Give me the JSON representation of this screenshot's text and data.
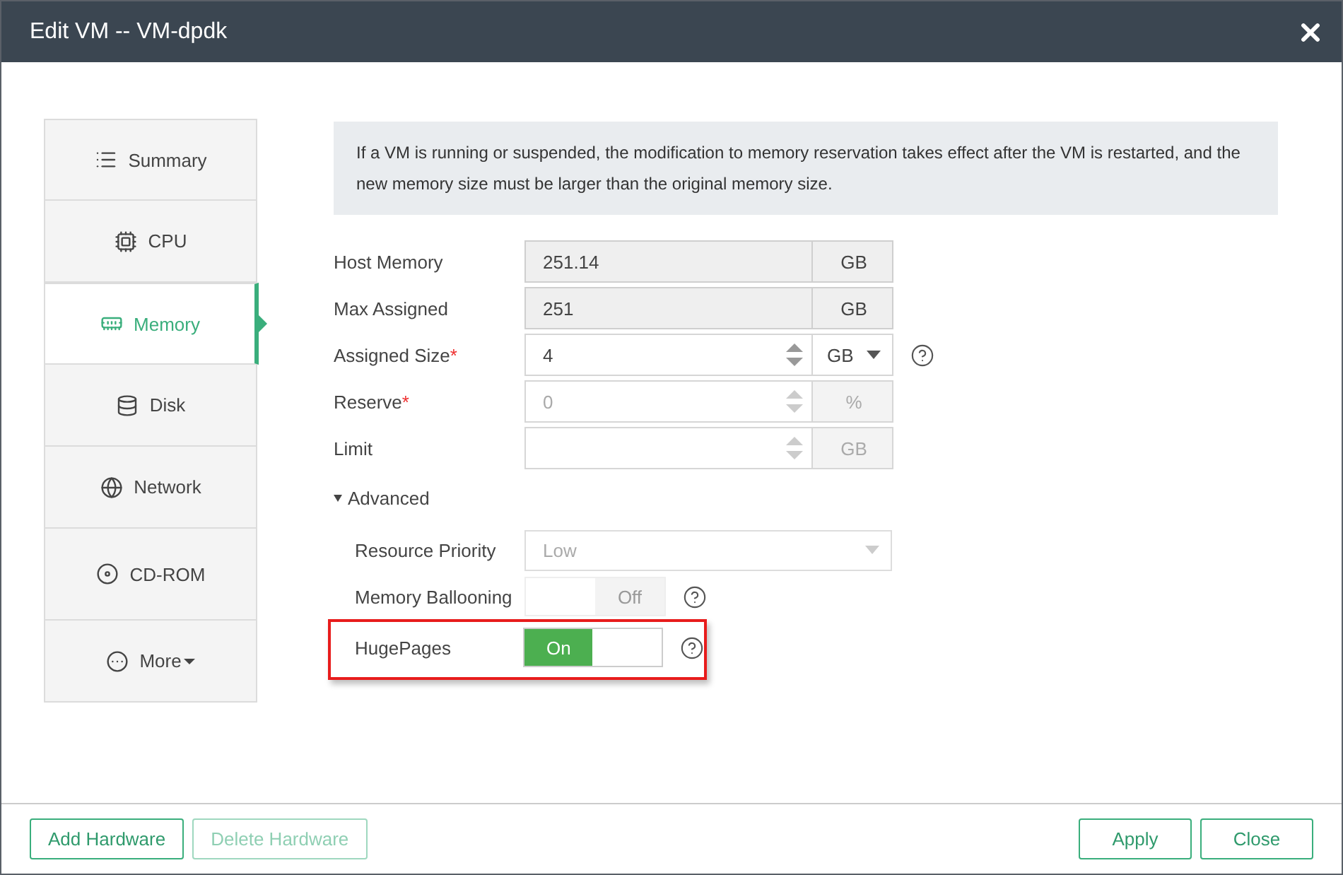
{
  "window": {
    "title": "Edit VM -- VM-dpdk"
  },
  "sidebar": {
    "items": [
      {
        "label": "Summary",
        "selected": false,
        "dropdown": false
      },
      {
        "label": "CPU",
        "selected": false,
        "dropdown": false
      },
      {
        "label": "Memory",
        "selected": true,
        "dropdown": false
      },
      {
        "label": "Disk",
        "selected": false,
        "dropdown": false
      },
      {
        "label": "Network",
        "selected": false,
        "dropdown": false
      },
      {
        "label": "CD-ROM",
        "selected": false,
        "dropdown": false
      },
      {
        "label": "More",
        "selected": false,
        "dropdown": true
      }
    ]
  },
  "notice": "If a VM is running or suspended, the modification to memory reservation takes effect after the VM is restarted, and the new memory size must be larger than the original memory size.",
  "fields": [
    {
      "kind": "readonly",
      "label": "Host Memory",
      "value": "251.14",
      "unit": "GB",
      "help": false
    },
    {
      "kind": "readonly",
      "label": "Max Assigned",
      "value": "251",
      "unit": "GB",
      "help": false
    },
    {
      "kind": "spinner",
      "label": "Assigned Size",
      "required_mark": "*",
      "value": "4",
      "unit": "GB",
      "unit_dropdown": true,
      "disabled": false,
      "help": true
    },
    {
      "kind": "spinner",
      "label": "Reserve",
      "required_mark": "*",
      "value": "0",
      "unit": "%",
      "unit_dropdown": false,
      "disabled": true,
      "help": false
    },
    {
      "kind": "spinner",
      "label": "Limit",
      "unit": "GB",
      "unit_dropdown": false,
      "disabled": true,
      "help": false
    }
  ],
  "advanced": {
    "label": "Advanced",
    "expanded": true,
    "items": [
      {
        "kind": "select",
        "label": "Resource Priority",
        "value": "Low",
        "disabled": true,
        "help": false,
        "highlighted": false
      },
      {
        "kind": "toggle",
        "label": "Memory Ballooning",
        "on": false,
        "text": "Off",
        "help": true,
        "highlighted": false
      },
      {
        "kind": "toggle",
        "label": "HugePages",
        "on": true,
        "text": "On",
        "help": true,
        "highlighted": true
      }
    ]
  },
  "footer": {
    "left": [
      {
        "label": "Add Hardware",
        "disabled": false
      },
      {
        "label": "Delete Hardware",
        "disabled": true
      }
    ],
    "right": [
      {
        "label": "Apply",
        "disabled": false
      },
      {
        "label": "Close",
        "disabled": false
      }
    ]
  }
}
